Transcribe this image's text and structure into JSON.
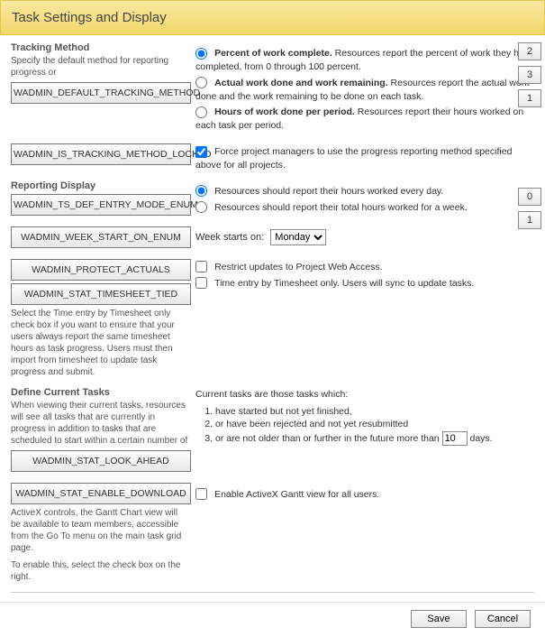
{
  "header": {
    "title": "Task Settings and Display"
  },
  "tracking": {
    "title": "Tracking Method",
    "desc": "Specify the default method for reporting progress or",
    "btn_default": "WADMIN_DEFAULT_TRACKING_METHOD",
    "btn_locked": "WADMIN_IS_TRACKING_METHOD_LOCKED",
    "opt1_b": "Percent of work complete.",
    "opt1_t": " Resources report the percent of work they have completed, from 0 through 100 percent.",
    "opt2_b": "Actual work done and work remaining.",
    "opt2_t": " Resources report the actual work done and the work remaining to be done on each task.",
    "opt3_b": "Hours of work done per period.",
    "opt3_t": " Resources report their hours worked on each task per period.",
    "badge1": "2",
    "badge2": "3",
    "badge3": "1",
    "force_label": "Force project managers to use the progress reporting method specified above for all projects."
  },
  "reporting": {
    "title": "Reporting Display",
    "btn_mode": "WADMIN_TS_DEF_ENTRY_MODE_ENUM",
    "opt1": "Resources should report their hours worked every day.",
    "opt2": "Resources should report their total hours worked for a week.",
    "badge1": "0",
    "badge2": "1",
    "btn_week": "WADMIN_WEEK_START_ON_ENUM",
    "week_label": "Week starts on:",
    "week_value": "Monday",
    "btn_protect": "WADMIN_PROTECT_ACTUALS",
    "btn_tied": "WADMIN_STAT_TIMESHEET_TIED",
    "restrict_label": "Restrict updates to Project Web Access.",
    "tied_label": "Time entry by Timesheet only. Users will sync to update tasks.",
    "tied_desc": "Select the Time entry by Timesheet only check box if you want to ensure that your users always report the same timesheet hours as task progress. Users must then import from timesheet to update task progress and submit."
  },
  "current": {
    "title": "Define Current Tasks",
    "desc": "When viewing their current tasks, resources will see all tasks that are currently in progress in addition to tasks that are scheduled to start within a certain number of",
    "btn_look": "WADMIN_STAT_LOOK_AHEAD",
    "right_lead": "Current tasks are those tasks which:",
    "li1": "have started but not yet finished,",
    "li2": "or have been rejected and not yet resubmitted",
    "li3a": "or are not older than or further in the future more than ",
    "li3_val": "10",
    "li3b": " days."
  },
  "gantt": {
    "btn_enable": "WADMIN_STAT_ENABLE_DOWNLOAD",
    "desc1": "ActiveX controls, the Gantt Chart view will be available to team members, accessible from the Go To menu on the main task grid page.",
    "desc2": "To enable this, select the check box on the right.",
    "check_label": "Enable ActiveX Gantt view for all users."
  },
  "footer": {
    "save": "Save",
    "cancel": "Cancel"
  }
}
